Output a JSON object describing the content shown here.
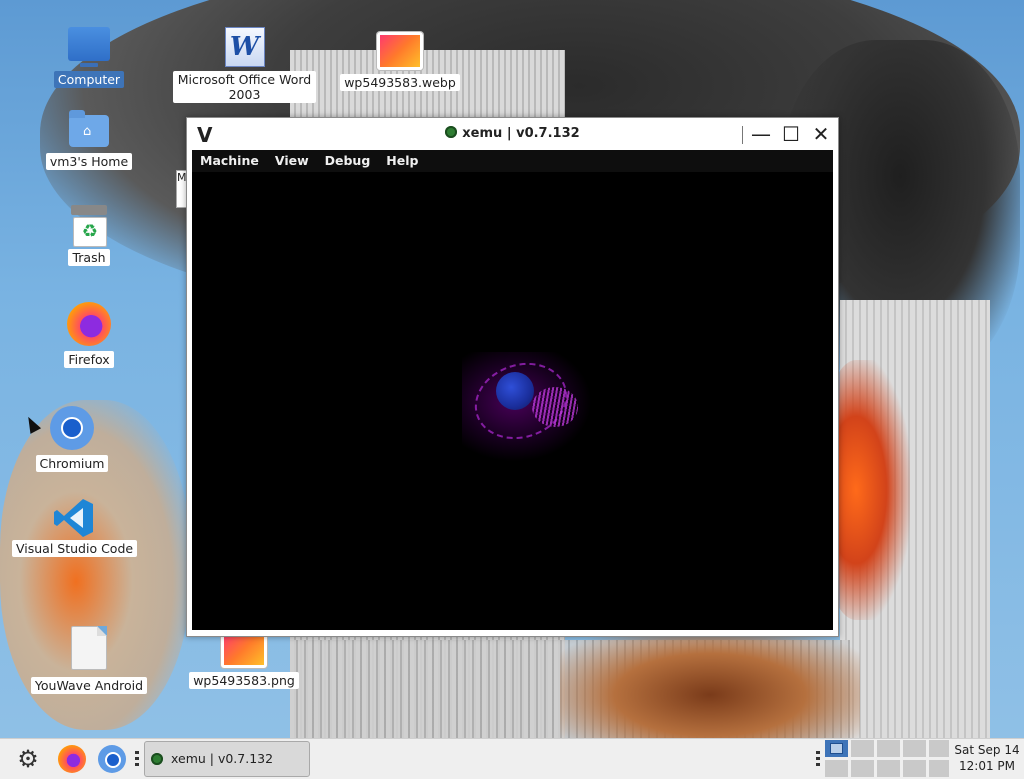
{
  "desktop": {
    "icons": [
      {
        "label": "Computer"
      },
      {
        "label": "vm3's Home"
      },
      {
        "label": "Trash"
      },
      {
        "label": "Firefox"
      },
      {
        "label": "Chromium"
      },
      {
        "label": "Visual Studio Code"
      },
      {
        "label": "YouWave Android"
      },
      {
        "label": "Microsoft Office Word 2003"
      },
      {
        "label": "wp5493583.webp"
      },
      {
        "label": "wp5493583.png"
      }
    ],
    "partial_window_letter": "M"
  },
  "window": {
    "logo": "V",
    "title": "xemu | v0.7.132",
    "controls": {
      "minimize": "—",
      "maximize": "☐",
      "close": "✕"
    },
    "menu": [
      "Machine",
      "View",
      "Debug",
      "Help"
    ]
  },
  "taskbar": {
    "start_glyph": "⚙",
    "task_label": "xemu | v0.7.132",
    "clock_day": "Sat Sep 14",
    "clock_time": "12:01 PM"
  },
  "colors": {
    "selection": "#3e74b8",
    "menubar": "#0e0e0e",
    "status_dot": "#2e7d32"
  }
}
